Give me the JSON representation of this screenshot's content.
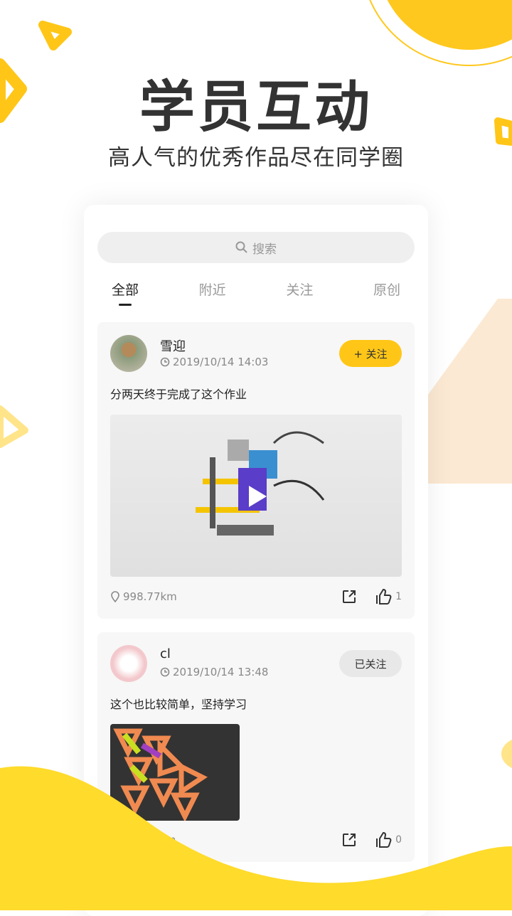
{
  "header": {
    "title": "学员互动",
    "subtitle": "高人气的优秀作品尽在同学圈"
  },
  "search": {
    "placeholder": "搜索"
  },
  "tabs": [
    {
      "label": "全部",
      "active": true
    },
    {
      "label": "附近"
    },
    {
      "label": "关注"
    },
    {
      "label": "原创"
    }
  ],
  "posts": [
    {
      "name": "雪迎",
      "time": "2019/10/14 14:03",
      "follow_label": "+ 关注",
      "content": "分两天终于完成了这个作业",
      "distance": "998.77km",
      "likes": "1"
    },
    {
      "name": "cl",
      "time": "2019/10/14 13:48",
      "follow_label": "已关注",
      "content": "这个也比较简单，坚持学习",
      "distance": "74km",
      "likes": "0"
    }
  ],
  "colors": {
    "accent": "#FFC617",
    "wave": "#FFDB2B"
  }
}
